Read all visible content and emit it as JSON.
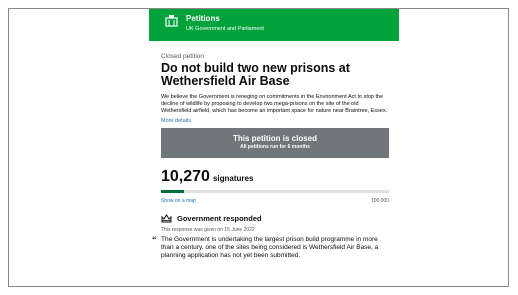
{
  "header": {
    "title": "Petitions",
    "subtitle": "UK Government and Parliament",
    "color": "#00a33b"
  },
  "petition": {
    "status_caption": "Closed petition",
    "title": "Do not build two new prisons at Wethersfield Air Base",
    "description": "We believe the Government is reneging on commitments in the Environment Act to stop the decline of wildlife by proposing to develop two mega-prisons on the site of the old Wethersfield airfield, which has become an important space for nature near Braintree, Essex.",
    "more_details_link": "More details"
  },
  "closed_banner": {
    "title": "This petition is closed",
    "subtitle": "All petitions run for 6 months"
  },
  "signatures": {
    "count": "10,270",
    "label": "signatures",
    "progress_fraction": 0.1027,
    "map_link": "Show on a map",
    "target": "100,000"
  },
  "response": {
    "icon": "crown-icon",
    "title": "Government responded",
    "date_text": "This response was given on 15 June 2022",
    "quote_mark": "“",
    "quote": "The Government is undertaking the largest prison build programme in more than a century, one of the sites being considered is Wethersfield Air Base, a planning application has not yet been submitted."
  }
}
